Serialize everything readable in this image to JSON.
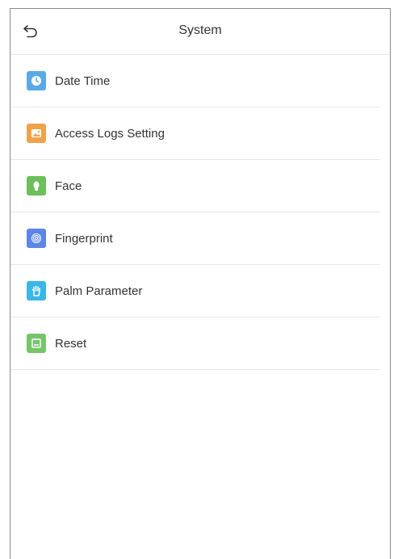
{
  "header": {
    "title": "System"
  },
  "menu": {
    "items": [
      {
        "label": "Date Time",
        "icon": "clock-icon",
        "color": "#5aa9e6"
      },
      {
        "label": "Access Logs Setting",
        "icon": "image-icon",
        "color": "#f0a24a"
      },
      {
        "label": "Face",
        "icon": "face-icon",
        "color": "#6cbf5a"
      },
      {
        "label": "Fingerprint",
        "icon": "fingerprint-icon",
        "color": "#5b86e5"
      },
      {
        "label": "Palm Parameter",
        "icon": "palm-icon",
        "color": "#38b6e6"
      },
      {
        "label": "Reset",
        "icon": "reset-icon",
        "color": "#77c46a"
      }
    ]
  }
}
